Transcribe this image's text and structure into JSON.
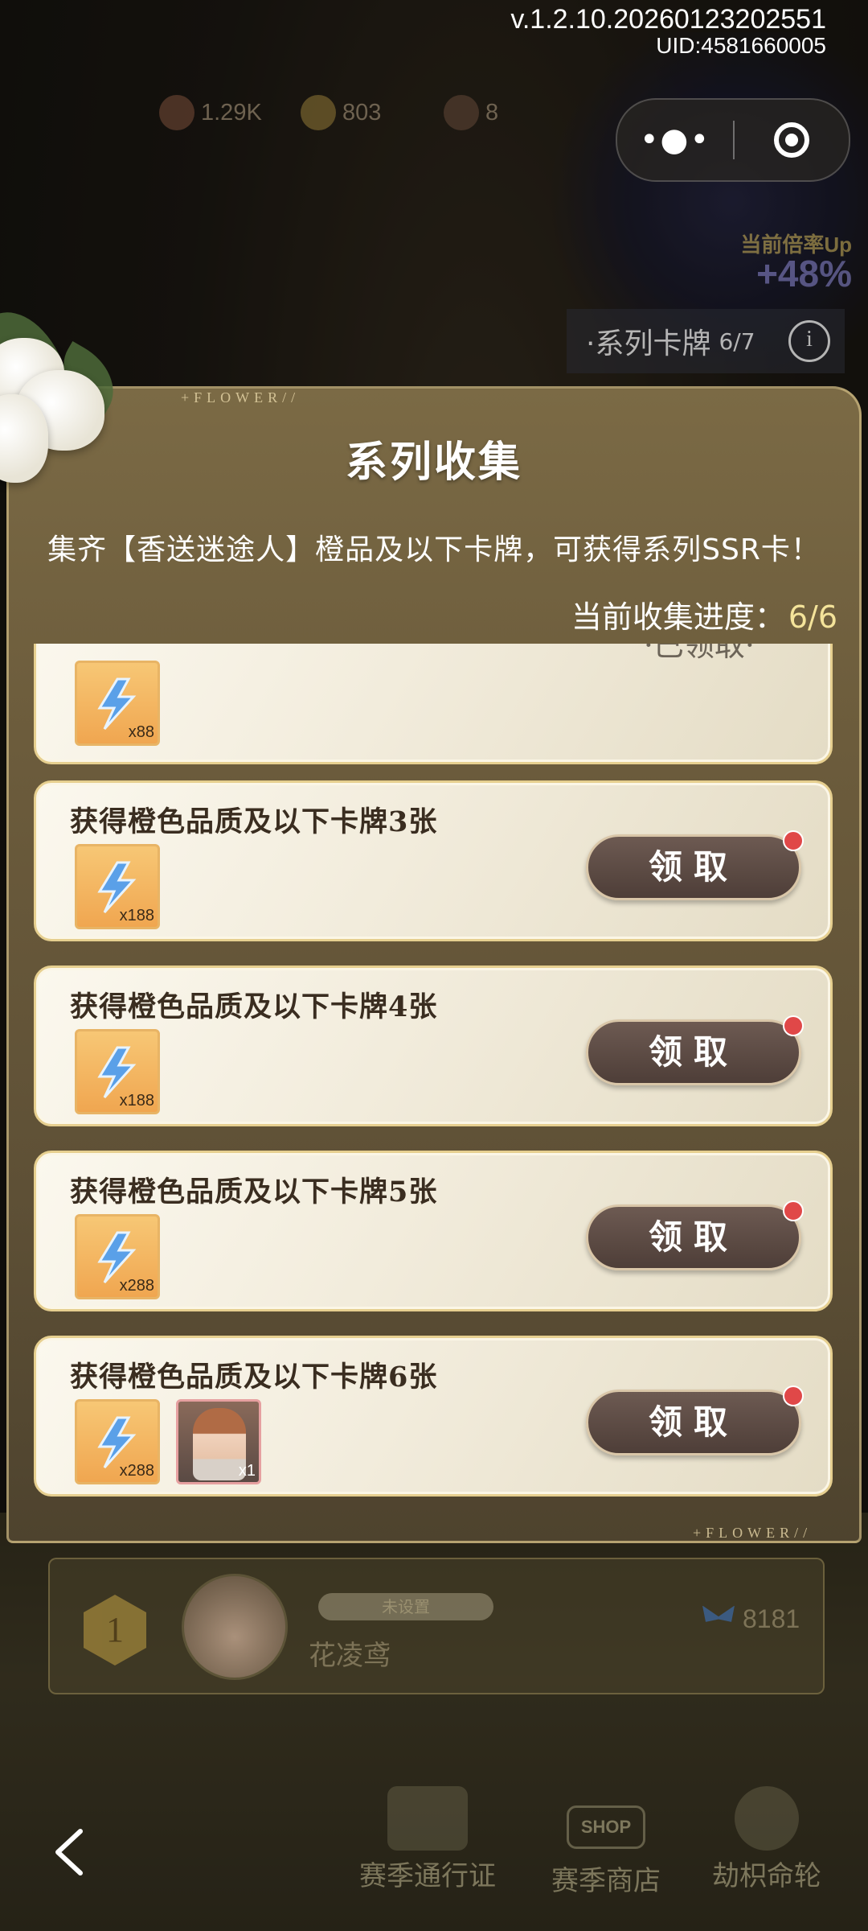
{
  "build": {
    "version": "v.1.2.10.20260123202551",
    "uid": "UID:4581660005"
  },
  "currencies": [
    {
      "icon": "gem-icon",
      "value": "1.29K"
    },
    {
      "icon": "coin-icon",
      "value": "803"
    },
    {
      "icon": "ticket-icon",
      "value": "8"
    }
  ],
  "boost": {
    "label": "当前倍率Up",
    "value": "+48%"
  },
  "series_chip": {
    "label": "·系列卡牌",
    "count": "6/7"
  },
  "panel": {
    "tag": "+FLOWER//",
    "title": "系列收集",
    "description": "集齐【香送迷途人】橙品及以下卡牌，可获得系列SSR卡！",
    "progress_label": "当前收集进度：",
    "progress_value": "6/6"
  },
  "rewards": [
    {
      "title": "",
      "items": [
        {
          "type": "energy",
          "qty": "x88"
        }
      ],
      "status": "·已领取·",
      "claimable": false
    },
    {
      "title": "获得橙色品质及以下卡牌3张",
      "items": [
        {
          "type": "energy",
          "qty": "x188"
        }
      ],
      "button": "领取",
      "claimable": true
    },
    {
      "title": "获得橙色品质及以下卡牌4张",
      "items": [
        {
          "type": "energy",
          "qty": "x188"
        }
      ],
      "button": "领取",
      "claimable": true
    },
    {
      "title": "获得橙色品质及以下卡牌5张",
      "items": [
        {
          "type": "energy",
          "qty": "x288"
        }
      ],
      "button": "领取",
      "claimable": true
    },
    {
      "title": "获得橙色品质及以下卡牌6张",
      "items": [
        {
          "type": "energy",
          "qty": "x288"
        },
        {
          "type": "character-card",
          "qty": "x1"
        }
      ],
      "button": "领取",
      "claimable": true
    }
  ],
  "leaderboard_row": {
    "rank": "1",
    "tag": "未设置",
    "name": "花凌鸢",
    "score": "8181"
  },
  "bottom_nav": {
    "pass": "赛季通行证",
    "shop": "赛季商店",
    "shop_sign": "SHOP",
    "wheel": "劫枳命轮"
  },
  "colors": {
    "panel": "#6c5c3c",
    "card": "#f2ecdc",
    "button": "#5a4942",
    "progress_value": "#f4e39a",
    "badge_dot": "#e04848"
  }
}
